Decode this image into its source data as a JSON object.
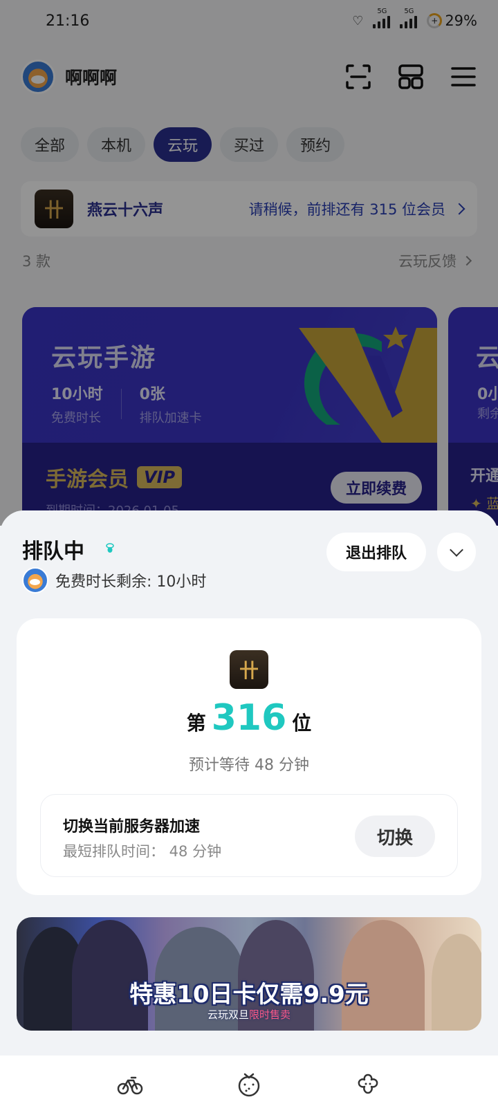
{
  "status_bar": {
    "time": "21:16",
    "network_label": "5G",
    "battery": "29%"
  },
  "header": {
    "user_name": "啊啊啊",
    "icons": [
      "scan-icon",
      "grid-icon",
      "menu-icon"
    ]
  },
  "tabs": [
    {
      "label": "全部",
      "active": false
    },
    {
      "label": "本机",
      "active": false
    },
    {
      "label": "云玩",
      "active": true
    },
    {
      "label": "买过",
      "active": false
    },
    {
      "label": "预约",
      "active": false
    }
  ],
  "queue_banner": {
    "game_name": "燕云十六声",
    "message": "请稍候，前排还有 315 位会员"
  },
  "list": {
    "count": "3 款",
    "feedback": "云玩反馈"
  },
  "member_card": {
    "title": "云玩手游",
    "stats": [
      {
        "value": "10小时",
        "label": "免费时长"
      },
      {
        "value": "0张",
        "label": "排队加速卡"
      }
    ],
    "vip_label": "手游会员",
    "vip_badge": "VIP",
    "renew_button": "立即续费",
    "expiry": "到期时间：2026.01.05"
  },
  "member_card_2": {
    "title": "云",
    "stat": "0小",
    "stat_label": "剩余",
    "open": "开通",
    "blue": "✦ 蓝"
  },
  "sheet": {
    "title": "排队中",
    "remaining": "免费时长剩余: 10小时",
    "exit_button": "退出排队",
    "queue": {
      "prefix": "第",
      "position": "316",
      "suffix": "位",
      "eta": "预计等待 48 分钟"
    },
    "server": {
      "title": "切换当前服务器加速",
      "subtitle": "最短排队时间： 48 分钟",
      "button": "切换"
    },
    "promo": {
      "main": "特惠10日卡仅需9.9元",
      "sub_prefix": "云玩双旦",
      "sub_highlight": "限时售卖"
    }
  },
  "bottom_nav": [
    "bike-icon",
    "strawberry-icon",
    "flower-icon"
  ],
  "colors": {
    "accent": "#2a2f8f",
    "queue_number": "#1fc8c0",
    "vip_gold": "#d8b95c",
    "card_purple": "#3b33c4"
  }
}
